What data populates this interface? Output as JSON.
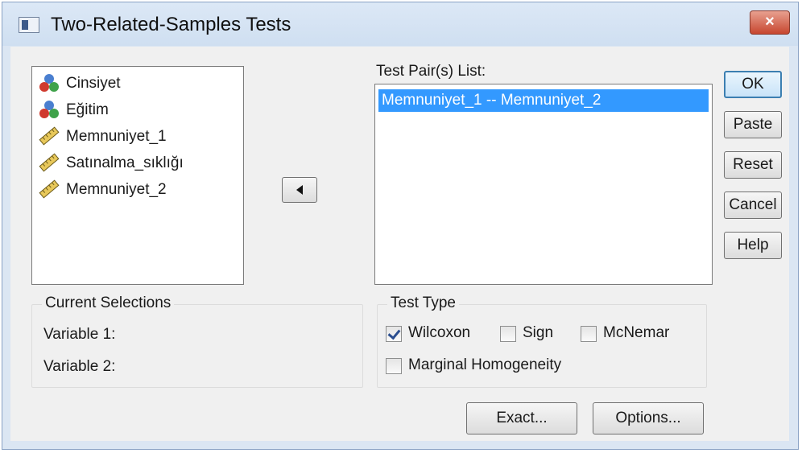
{
  "window": {
    "title": "Two-Related-Samples Tests",
    "close_label": "×"
  },
  "variables": [
    {
      "label": "Cinsiyet",
      "icon": "nominal-icon"
    },
    {
      "label": "Eğitim",
      "icon": "nominal-icon"
    },
    {
      "label": "Memnuniyet_1",
      "icon": "scale-ruler-icon"
    },
    {
      "label": "Satınalma_sıklığı",
      "icon": "scale-ruler-icon"
    },
    {
      "label": "Memnuniyet_2",
      "icon": "scale-ruler-icon"
    }
  ],
  "test_pairs": {
    "label": "Test Pair(s) List:",
    "items": [
      "Memnuniyet_1 -- Memnuniyet_2"
    ]
  },
  "current_selections": {
    "label": "Current Selections",
    "variable1": "Variable 1:",
    "variable2": "Variable 2:"
  },
  "test_type": {
    "label": "Test Type",
    "wilcoxon": {
      "label": "Wilcoxon",
      "checked": true
    },
    "sign": {
      "label": "Sign",
      "checked": false
    },
    "mcnemar": {
      "label": "McNemar",
      "checked": false
    },
    "marginal": {
      "label": "Marginal Homogeneity",
      "checked": false
    }
  },
  "buttons": {
    "ok": "OK",
    "paste": "Paste",
    "reset": "Reset",
    "cancel": "Cancel",
    "help": "Help",
    "exact": "Exact...",
    "options": "Options..."
  },
  "colors": {
    "selection": "#3399ff",
    "dialog_bg": "#f0f0f0",
    "frame": "#dbe6f3"
  }
}
